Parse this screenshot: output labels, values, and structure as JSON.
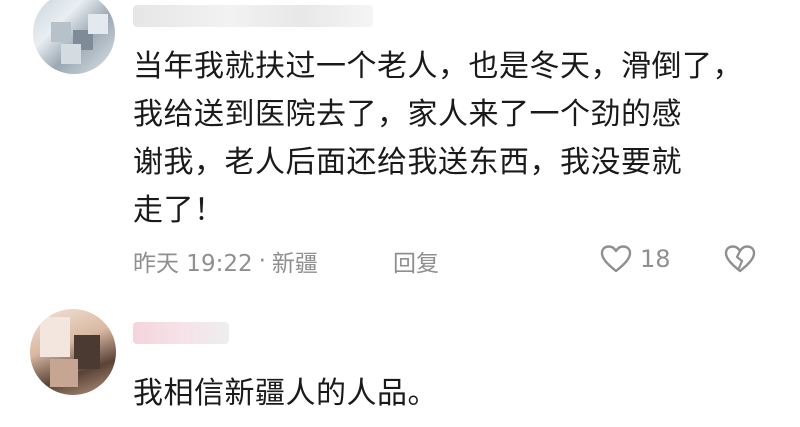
{
  "comments": [
    {
      "text_lines": [
        "当年我就扶过一个老人，也是冬天，滑倒了，",
        "我给送到医院去了，家人来了一个劲的感",
        "谢我，老人后面还给我送东西，我没要就",
        "走了！"
      ],
      "time": "昨天 19:22",
      "separator": "·",
      "location": "新疆",
      "reply_label": "回复",
      "like_count": "18",
      "like_icon": "heart-outline-icon",
      "dislike_icon": "broken-heart-icon"
    },
    {
      "text_lines": [
        "我相信新疆人的人品。"
      ]
    }
  ],
  "colors": {
    "text": "#1a1a1a",
    "meta": "#8f8f8f",
    "background": "#ffffff"
  }
}
